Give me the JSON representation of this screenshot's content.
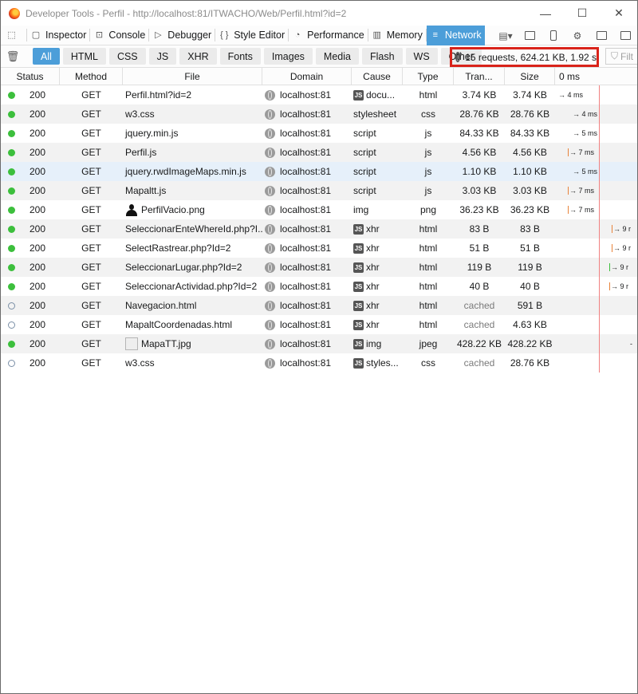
{
  "window": {
    "title": "Developer Tools - Perfil - http://localhost:81/ITWACHO/Web/Perfil.html?id=2",
    "controls": {
      "minimize": "—",
      "maximize": "☐",
      "close": "✕"
    }
  },
  "toolbar": {
    "tabs": [
      {
        "label": "Inspector",
        "icon": "inspector-icon",
        "glyph": "▢"
      },
      {
        "label": "Console",
        "icon": "console-icon",
        "glyph": "⊡"
      },
      {
        "label": "Debugger",
        "icon": "debugger-icon",
        "glyph": "▷"
      },
      {
        "label": "Style Editor",
        "icon": "style-editor-icon",
        "glyph": "{ }"
      },
      {
        "label": "Performance",
        "icon": "performance-icon",
        "glyph": "◔"
      },
      {
        "label": "Memory",
        "icon": "memory-icon",
        "glyph": "▥"
      },
      {
        "label": "Network",
        "icon": "network-icon",
        "glyph": "≡",
        "selected": true
      }
    ]
  },
  "filters": {
    "buttons": [
      "All",
      "HTML",
      "CSS",
      "JS",
      "XHR",
      "Fonts",
      "Images",
      "Media",
      "Flash",
      "WS",
      "Other"
    ],
    "active": "All",
    "summary": "15 requests, 624.21 KB, 1.92 s",
    "placeholder": "Filt"
  },
  "columns": [
    "Status",
    "Method",
    "File",
    "Domain",
    "Cause",
    "Type",
    "Tran...",
    "Size",
    "0 ms"
  ],
  "requests": [
    {
      "status": "200",
      "method": "GET",
      "file": "Perfil.html?id=2",
      "domain": "localhost:81",
      "cause": "docu...",
      "cause_js": true,
      "type": "html",
      "transferred": "3.74 KB",
      "size": "3.74 KB",
      "timing": "→ 4 ms",
      "cached": false
    },
    {
      "status": "200",
      "method": "GET",
      "file": "w3.css",
      "domain": "localhost:81",
      "cause": "stylesheet",
      "cause_js": false,
      "type": "css",
      "transferred": "28.76 KB",
      "size": "28.76 KB",
      "timing": "→ 4 ms",
      "cached": false
    },
    {
      "status": "200",
      "method": "GET",
      "file": "jquery.min.js",
      "domain": "localhost:81",
      "cause": "script",
      "cause_js": false,
      "type": "js",
      "transferred": "84.33 KB",
      "size": "84.33 KB",
      "timing": "→ 5 ms",
      "cached": false
    },
    {
      "status": "200",
      "method": "GET",
      "file": "Perfil.js",
      "domain": "localhost:81",
      "cause": "script",
      "cause_js": false,
      "type": "js",
      "transferred": "4.56 KB",
      "size": "4.56 KB",
      "timing": "→ 7 ms",
      "cached": false
    },
    {
      "status": "200",
      "method": "GET",
      "file": "jquery.rwdImageMaps.min.js",
      "domain": "localhost:81",
      "cause": "script",
      "cause_js": false,
      "type": "js",
      "transferred": "1.10 KB",
      "size": "1.10 KB",
      "timing": "→ 5 ms",
      "cached": false
    },
    {
      "status": "200",
      "method": "GET",
      "file": "Mapaltt.js",
      "domain": "localhost:81",
      "cause": "script",
      "cause_js": false,
      "type": "js",
      "transferred": "3.03 KB",
      "size": "3.03 KB",
      "timing": "→ 7 ms",
      "cached": false
    },
    {
      "status": "200",
      "method": "GET",
      "file": "PerfilVacio.png",
      "domain": "localhost:81",
      "cause": "img",
      "cause_js": false,
      "type": "png",
      "transferred": "36.23 KB",
      "size": "36.23 KB",
      "timing": "→ 7 ms",
      "cached": false,
      "thumb": "avatar"
    },
    {
      "status": "200",
      "method": "GET",
      "file": "SeleccionarEnteWhereId.php?I...",
      "domain": "localhost:81",
      "cause": "xhr",
      "cause_js": true,
      "type": "html",
      "transferred": "83 B",
      "size": "83 B",
      "timing": "→ 9 r",
      "cached": false
    },
    {
      "status": "200",
      "method": "GET",
      "file": "SelectRastrear.php?Id=2",
      "domain": "localhost:81",
      "cause": "xhr",
      "cause_js": true,
      "type": "html",
      "transferred": "51 B",
      "size": "51 B",
      "timing": "→ 9 r",
      "cached": false
    },
    {
      "status": "200",
      "method": "GET",
      "file": "SeleccionarLugar.php?Id=2",
      "domain": "localhost:81",
      "cause": "xhr",
      "cause_js": true,
      "type": "html",
      "transferred": "119 B",
      "size": "119 B",
      "timing": "→ 9 r",
      "cached": false
    },
    {
      "status": "200",
      "method": "GET",
      "file": "SeleccionarActividad.php?Id=2",
      "domain": "localhost:81",
      "cause": "xhr",
      "cause_js": true,
      "type": "html",
      "transferred": "40 B",
      "size": "40 B",
      "timing": "→ 9 r",
      "cached": false
    },
    {
      "status": "200",
      "method": "GET",
      "file": "Navegacion.html",
      "domain": "localhost:81",
      "cause": "xhr",
      "cause_js": true,
      "type": "html",
      "transferred": "cached",
      "size": "591 B",
      "timing": "",
      "cached": true
    },
    {
      "status": "200",
      "method": "GET",
      "file": "MapaltCoordenadas.html",
      "domain": "localhost:81",
      "cause": "xhr",
      "cause_js": true,
      "type": "html",
      "transferred": "cached",
      "size": "4.63 KB",
      "timing": "",
      "cached": true
    },
    {
      "status": "200",
      "method": "GET",
      "file": "MapaTT.jpg",
      "domain": "localhost:81",
      "cause": "img",
      "cause_js": true,
      "type": "jpeg",
      "transferred": "428.22 KB",
      "size": "428.22 KB",
      "timing": "-",
      "cached": false,
      "thumb": "map"
    },
    {
      "status": "200",
      "method": "GET",
      "file": "w3.css",
      "domain": "localhost:81",
      "cause": "styles...",
      "cause_js": true,
      "type": "css",
      "transferred": "cached",
      "size": "28.76 KB",
      "timing": "",
      "cached": true
    }
  ],
  "colors": {
    "accent": "#4c9ed9",
    "status_ok": "#3cbf3c",
    "highlight": "#d9231a"
  }
}
